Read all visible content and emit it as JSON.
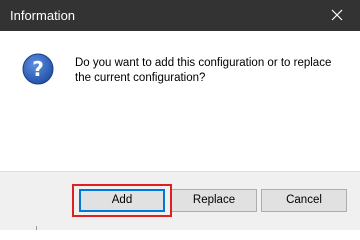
{
  "dialog": {
    "title": "Information",
    "close_glyph": "close-icon",
    "icon": "question-icon",
    "message": "Do you want to add this configuration or to replace the current configuration?",
    "buttons": {
      "add": "Add",
      "replace": "Replace",
      "cancel": "Cancel"
    }
  },
  "colors": {
    "titlebar": "#333333",
    "icon_blue": "#1f4fa6",
    "focus_border": "#0078d7",
    "highlight": "#e02020"
  }
}
